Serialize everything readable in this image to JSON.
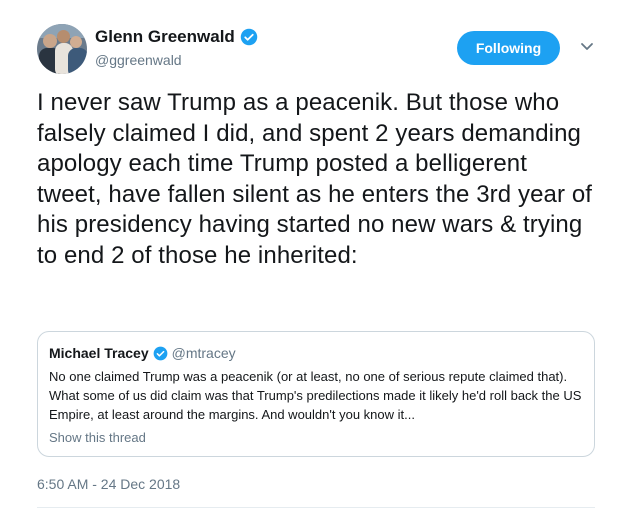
{
  "tweet": {
    "author_name": "Glenn Greenwald",
    "author_handle": "@ggreenwald",
    "follow_label": "Following",
    "text": "I never saw Trump as a peacenik. But those who falsely claimed I did, and spent 2 years demanding apology each time Trump posted a belligerent tweet, have fallen silent as he enters the 3rd year of his presidency having started no new wars & trying to end 2 of those he inherited:",
    "timestamp": "6:50 AM - 24 Dec 2018"
  },
  "quoted": {
    "author_name": "Michael Tracey",
    "author_handle": "@mtracey",
    "text": "No one claimed Trump was a peacenik (or at least, no one of serious repute claimed that). What some of us did claim was that Trump's predilections made it likely he'd roll back the US Empire, at least around the margins. And wouldn't you know it...",
    "show_thread": "Show this thread"
  },
  "colors": {
    "accent": "#1da1f2",
    "secondary_text": "#657786",
    "border": "#ccd6dd"
  },
  "icons": {
    "verified": "verified-badge-icon",
    "menu": "chevron-down-icon"
  }
}
